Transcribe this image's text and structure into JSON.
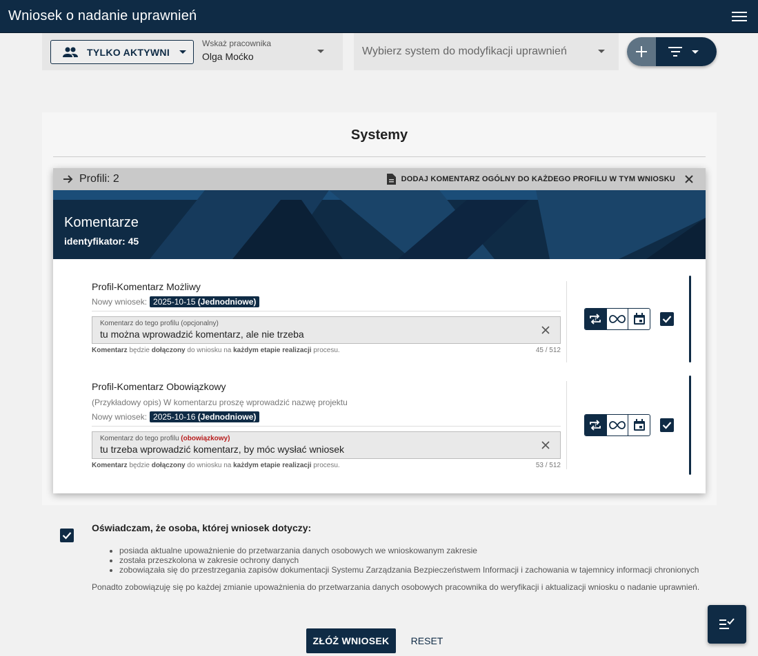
{
  "app": {
    "title": "Wniosek o nadanie uprawnień"
  },
  "filters": {
    "active_label": "TYLKO AKTYWNI",
    "employee_label": "Wskaż pracownika",
    "employee_value": "Olga Moćko",
    "system_placeholder": "Wybierz system do modyfikacji uprawnień"
  },
  "systems": {
    "title": "Systemy",
    "panel": {
      "profiles_count_label": "Profili: 2",
      "general_comment_label": "DODAJ KOMENTARZ OGÓLNY DO KAŻDEGO PROFILU W TYM WNIOSKU",
      "system_name": "Komentarze",
      "identifier": "identyfikator: 45",
      "profiles": [
        {
          "name": "Profil-Komentarz Możliwy",
          "description": "",
          "new_request_label": "Nowy wniosek:",
          "date": "2025-10-15",
          "type": "(Jednodniowe)",
          "field_label": "Komentarz do tego profilu",
          "field_tag": "(opcjonalny)",
          "comment": "tu można wprowadzić komentarz, ale nie trzeba",
          "counter": "45 / 512",
          "checked": true
        },
        {
          "name": "Profil-Komentarz Obowiązkowy",
          "description": "(Przykładowy opis) W komentarzu proszę wprowadzić nazwę projektu",
          "new_request_label": "Nowy wniosek:",
          "date": "2025-10-16",
          "type": "(Jednodniowe)",
          "field_label": "Komentarz do tego profilu",
          "field_tag": "(obowiązkowy)",
          "comment": "tu trzeba wprowadzić komentarz, by móc wysłać wniosek",
          "counter": "53 / 512",
          "checked": true
        }
      ],
      "hint": {
        "w1": "Komentarz",
        "w2": " będzie ",
        "w3": "dołączony",
        "w4": " do wniosku na ",
        "w5": "każdym etapie realizacji",
        "w6": " procesu."
      }
    }
  },
  "declaration": {
    "checked": true,
    "title": "Oświadczam, że osoba, której wniosek dotyczy:",
    "items": [
      "posiada aktualne upoważnienie do przetwarzania danych osobowych we wnioskowanym zakresie",
      "została przeszkolona w zakresie ochrony danych",
      "zobowiązała się do przestrzegania zapisów dokumentacji Systemu Zarządzania Bezpieczeństwem Informacji i zachowania w tajemnicy informacji chronionych"
    ],
    "paragraph": "Ponadto zobowiązuję się po każdej zmianie upoważnienia do przetwarzania danych osobowych pracownika do weryfikacji i aktualizacji wniosku o nadanie uprawnień."
  },
  "actions": {
    "submit": "ZŁÓŻ WNIOSEK",
    "reset": "RESET"
  },
  "colors": {
    "primary": "#0f2b45",
    "required": "#b71c1c"
  }
}
